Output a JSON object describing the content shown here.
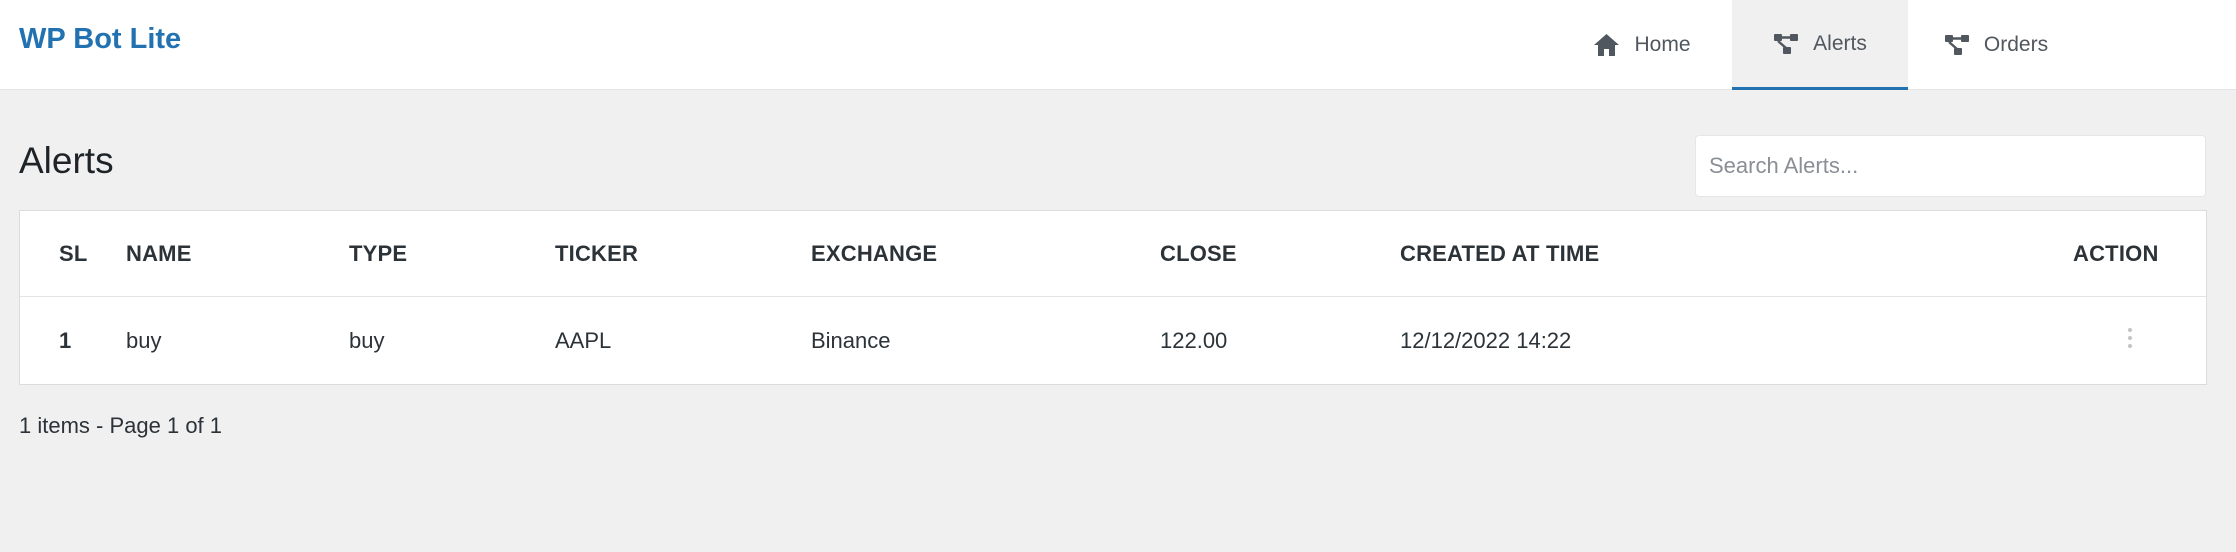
{
  "app": {
    "brand": "WP Bot Lite"
  },
  "nav": {
    "items": [
      {
        "label": "Home",
        "icon": "home-icon",
        "active": false
      },
      {
        "label": "Alerts",
        "icon": "nodes-icon",
        "active": true
      },
      {
        "label": "Orders",
        "icon": "nodes-icon",
        "active": false
      }
    ]
  },
  "page": {
    "title": "Alerts"
  },
  "search": {
    "placeholder": "Search Alerts...",
    "value": ""
  },
  "table": {
    "columns": [
      "SL",
      "NAME",
      "TYPE",
      "TICKER",
      "EXCHANGE",
      "CLOSE",
      "CREATED AT TIME",
      "ACTION"
    ],
    "rows": [
      {
        "sl": "1",
        "name": "buy",
        "type": "buy",
        "ticker": "AAPL",
        "exchange": "Binance",
        "close": "122.00",
        "created_at": "12/12/2022 14:22",
        "action_icon": "more-vertical-icon"
      }
    ]
  },
  "pagination": {
    "text_prefix": "1 items - Page ",
    "page": "1",
    "text_mid": " of ",
    "total": "1"
  },
  "colors": {
    "brand": "#2271b1",
    "background": "#f0f0f1",
    "nav_icon": "#50575e"
  }
}
